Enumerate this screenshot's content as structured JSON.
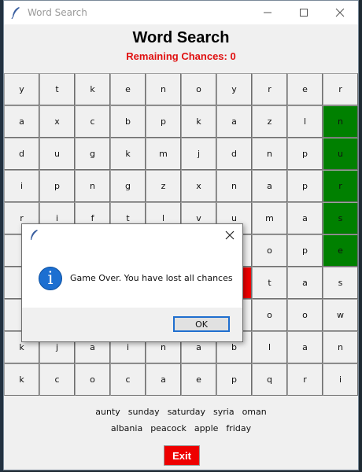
{
  "window": {
    "title": "Word Search"
  },
  "heading": "Word Search",
  "chances": "Remaining Chances: 0",
  "grid": [
    [
      "y",
      "t",
      "k",
      "e",
      "n",
      "o",
      "y",
      "r",
      "e",
      "r"
    ],
    [
      "a",
      "x",
      "c",
      "b",
      "p",
      "k",
      "a",
      "z",
      "l",
      "n"
    ],
    [
      "d",
      "u",
      "g",
      "k",
      "m",
      "j",
      "d",
      "n",
      "p",
      "u"
    ],
    [
      "i",
      "p",
      "n",
      "g",
      "z",
      "x",
      "n",
      "a",
      "p",
      "r"
    ],
    [
      "r",
      "i",
      "f",
      "t",
      "l",
      "v",
      "u",
      "m",
      "a",
      "s"
    ],
    [
      "",
      "",
      "",
      "",
      "",
      "",
      "",
      "o",
      "p",
      "e"
    ],
    [
      "",
      "",
      "",
      "",
      "",
      "",
      "",
      "t",
      "a",
      "s"
    ],
    [
      "",
      "",
      "",
      "",
      "",
      "",
      "",
      "o",
      "o",
      "w"
    ],
    [
      "k",
      "j",
      "a",
      "i",
      "n",
      "a",
      "b",
      "l",
      "a",
      "n"
    ],
    [
      "k",
      "c",
      "o",
      "c",
      "a",
      "e",
      "p",
      "q",
      "r",
      "i"
    ]
  ],
  "highlights": {
    "green": [
      [
        1,
        9
      ],
      [
        2,
        9
      ],
      [
        3,
        9
      ],
      [
        4,
        9
      ],
      [
        5,
        9
      ]
    ],
    "red": [
      [
        6,
        6
      ]
    ]
  },
  "colors": {
    "found": "#008000",
    "wrong": "#ee0000",
    "exit": "#ee0000",
    "chances": "#e01010"
  },
  "words_row1": [
    "aunty",
    "sunday",
    "saturday",
    "syria",
    "oman"
  ],
  "words_row2": [
    "albania",
    "peacock",
    "apple",
    "friday"
  ],
  "exit_label": "Exit",
  "dialog": {
    "message": "Game Over. You have lost all chances",
    "ok_label": "OK",
    "icon": "info-icon"
  }
}
